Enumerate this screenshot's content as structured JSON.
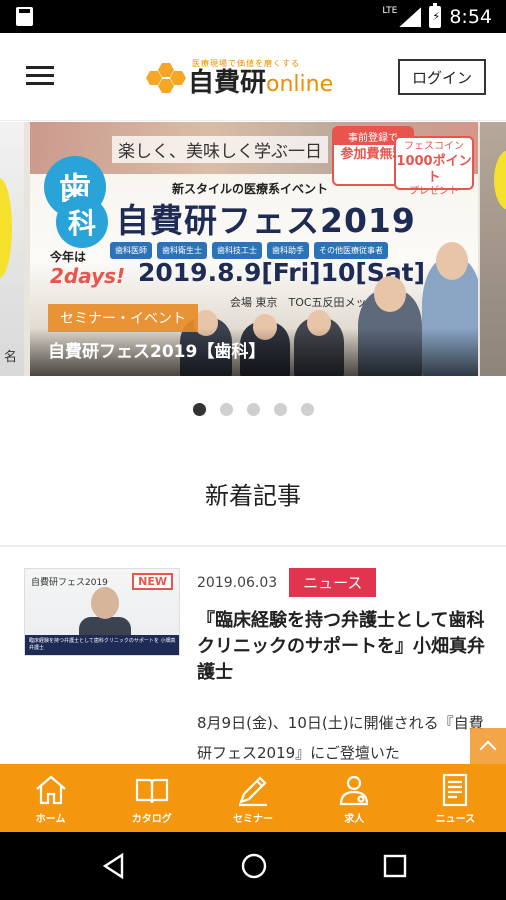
{
  "status_bar": {
    "network": "LTE",
    "time": "8:54"
  },
  "header": {
    "logo_tagline": "医療現場で価値を磨くする",
    "logo_main": "自費研",
    "logo_suffix": "online",
    "login_label": "ログイン"
  },
  "carousel": {
    "left_peek_text": "名",
    "slide": {
      "tagline": "楽しく、美味しく学ぶ一日",
      "badge_top": "歯",
      "badge_bottom": "科",
      "promo1_head": "事前登録で",
      "promo1_body": "参加費無料",
      "promo2_line1": "フェスコイン",
      "promo2_line2": "1000ポイント",
      "promo2_line3": "プレゼント",
      "new_style": "新スタイルの医療系イベント",
      "fest_title": "自費研フェス2019",
      "chips": [
        "歯科医師",
        "歯科衛生士",
        "歯科技工士",
        "歯科助手",
        "その他医療従事者"
      ],
      "this_year": "今年は",
      "two_days": "2days!",
      "date_text": "2019.8.9[Fri]10[Sat]",
      "venue": "会場 東京　TOC五反田メッセ",
      "category_tag": "セミナー・イベント",
      "slide_title": "自費研フェス2019【歯科】"
    },
    "dots_total": 5,
    "dots_active_index": 0
  },
  "section": {
    "title": "新着記事"
  },
  "article": {
    "thumb_logo": "自費研フェス2019",
    "thumb_new": "NEW",
    "thumb_caption": "臨床経験を持つ弁護士として歯科クリニックのサポートを 小畑真弁護士",
    "date": "2019.06.03",
    "category": "ニュース",
    "title": "『臨床経験を持つ弁護士として歯科クリニックのサポートを』小畑真弁護士",
    "excerpt": "8月9日(金)、10日(土)に開催される『自費研フェス2019』にご登壇いた"
  },
  "tabbar": {
    "items": [
      {
        "label": "ホーム",
        "icon": "home-icon"
      },
      {
        "label": "カタログ",
        "icon": "catalog-icon"
      },
      {
        "label": "セミナー",
        "icon": "pen-icon"
      },
      {
        "label": "求人",
        "icon": "person-icon"
      },
      {
        "label": "ニュース",
        "icon": "document-icon"
      }
    ]
  },
  "colors": {
    "accent_orange": "#f5960f",
    "news_red": "#e0344f",
    "brand_blue": "#29a3d8",
    "title_navy": "#1e2b55"
  }
}
